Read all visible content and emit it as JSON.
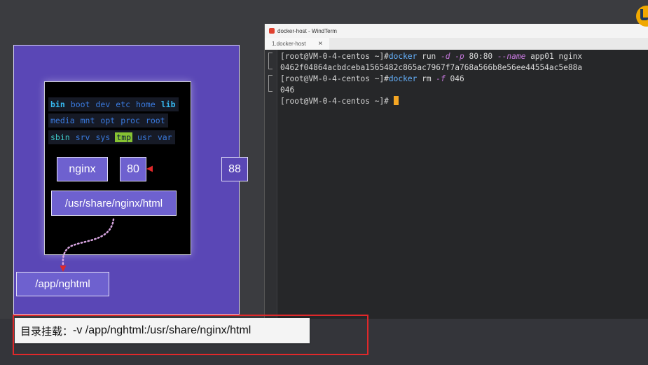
{
  "window": {
    "title": "docker-host - WindTerm",
    "tab_label": "1.docker-host",
    "tab_close": "×"
  },
  "diagram": {
    "dir_rows": [
      [
        "bin",
        "boot",
        "dev",
        "etc",
        "home",
        "lib"
      ],
      [
        "media",
        "mnt",
        "opt",
        "proc",
        "root"
      ],
      [
        "sbin",
        "srv",
        "sys",
        "tmp",
        "usr",
        "var"
      ]
    ],
    "nginx_label": "nginx",
    "container_port": "80",
    "host_port": "88",
    "container_path": "/usr/share/nginx/html",
    "host_path": "/app/nghtml"
  },
  "terminal": {
    "lines": [
      {
        "prompt": "[root@VM-0-4-centos ~]#",
        "cmd": "docker",
        "rest": [
          " run ",
          {
            "flag": "-d"
          },
          " ",
          {
            "flag": "-p"
          },
          " 80:80 ",
          {
            "flag": "--name"
          },
          " app01 nginx"
        ]
      },
      {
        "output": "0462f04864acbdceba1565482c865ac7967f7a768a566b8e56ee44554ac5e88a"
      },
      {
        "prompt": "[root@VM-0-4-centos ~]#",
        "cmd": "docker",
        "rest": [
          " rm ",
          {
            "flag": "-f"
          },
          " 046"
        ]
      },
      {
        "output": "046"
      },
      {
        "prompt": "[root@VM-0-4-centos ~]#",
        "cursor": true
      }
    ]
  },
  "caption": {
    "label": "目录挂载：",
    "text": "-v /app/nghtml:/usr/share/nginx/html"
  },
  "colors": {
    "host_panel": "#5a47b6",
    "box": "#6e61cf",
    "arrow": "#e0282a",
    "dots": "#d0a8e0",
    "cursor": "#f5a623",
    "caption_frame": "#e0282a"
  }
}
